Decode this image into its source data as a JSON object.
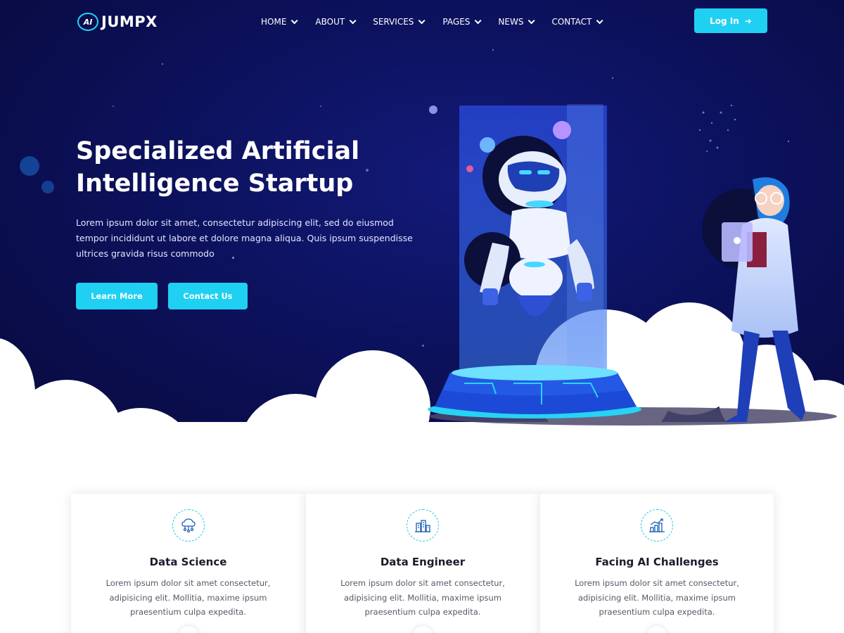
{
  "brand": {
    "mark": "AI",
    "name": "JUMPX"
  },
  "nav": {
    "items": [
      {
        "label": "HOME"
      },
      {
        "label": "ABOUT"
      },
      {
        "label": "SERVICES"
      },
      {
        "label": "PAGES"
      },
      {
        "label": "NEWS"
      },
      {
        "label": "CONTACT"
      }
    ],
    "login_label": "Log In"
  },
  "hero": {
    "title_line1": "Specialized Artificial",
    "title_line2": "Intelligence Startup",
    "description": "Lorem ipsum dolor sit amet, consectetur adipiscing elit, sed do eiusmod tempor incididunt ut labore et dolore magna aliqua. Quis ipsum suspendisse ultrices gravida risus commodo",
    "primary_button": "Learn More",
    "secondary_button": "Contact Us"
  },
  "features": [
    {
      "icon": "cloud-network-icon",
      "title": "Data Science",
      "text": "Lorem ipsum dolor sit amet consectetur, adipisicing elit. Mollitia, maxime ipsum praesentium culpa expedita."
    },
    {
      "icon": "data-building-icon",
      "title": "Data Engineer",
      "text": "Lorem ipsum dolor sit amet consectetur, adipisicing elit. Mollitia, maxime ipsum praesentium culpa expedita."
    },
    {
      "icon": "growth-chart-icon",
      "title": "Facing AI Challenges",
      "text": "Lorem ipsum dolor sit amet consectetur, adipisicing elit. Mollitia, maxime ipsum praesentium culpa expedita."
    }
  ],
  "colors": {
    "accent": "#1fd0f2",
    "hero_bg": "#0d1260",
    "text_dark": "#1b1b2e"
  }
}
